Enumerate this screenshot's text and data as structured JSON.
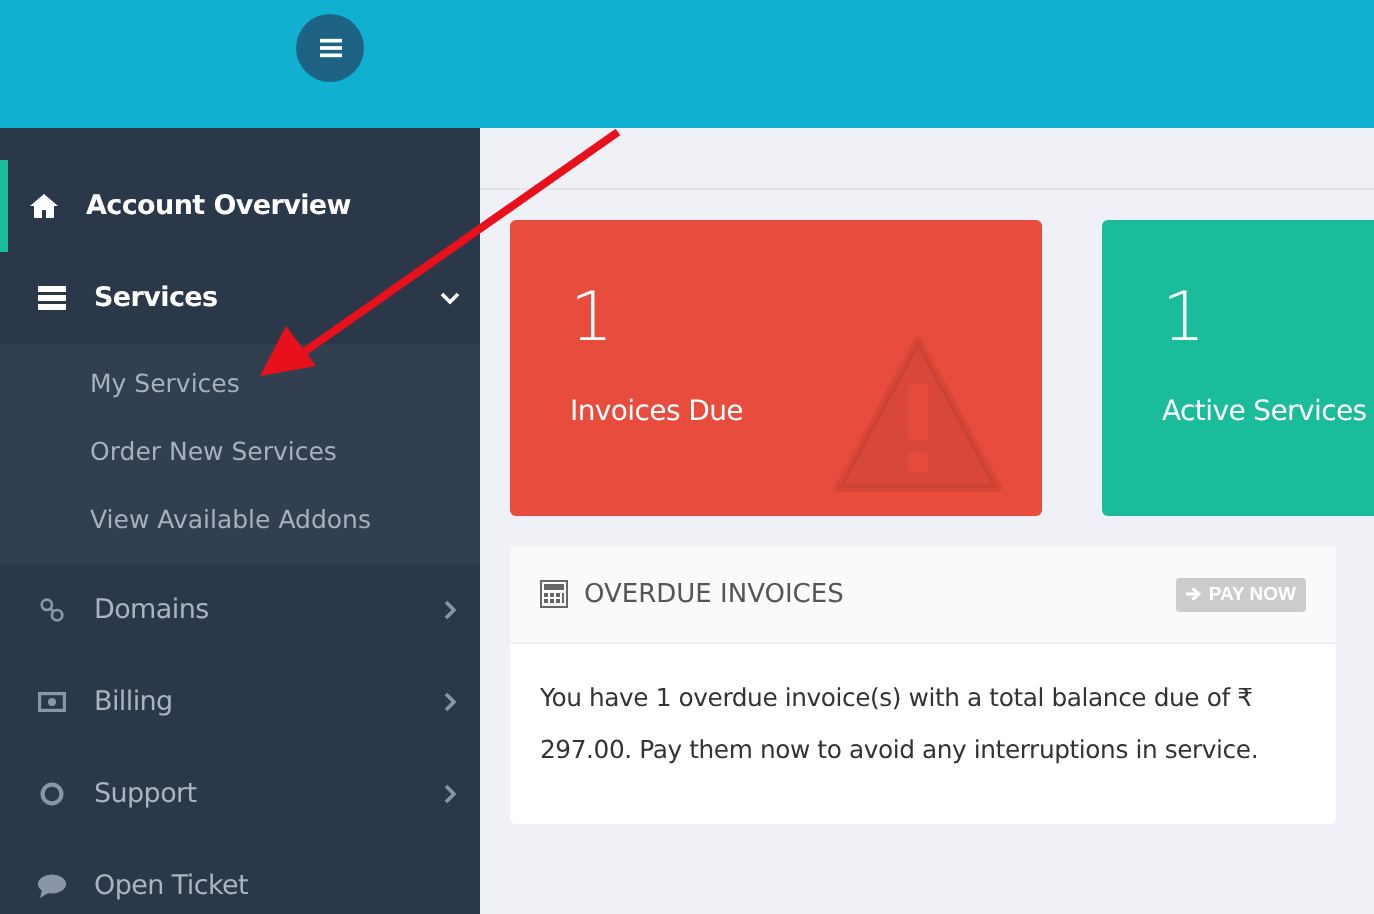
{
  "sidebar": {
    "items": [
      {
        "kind": "link",
        "label": "Account Overview",
        "selected": true
      },
      {
        "kind": "menu",
        "label": "Services",
        "selected": false,
        "expanded": true,
        "children": [
          {
            "label": "My Services"
          },
          {
            "label": "Order New Services"
          },
          {
            "label": "View Available Addons"
          }
        ]
      },
      {
        "kind": "menu",
        "label": "Domains",
        "selected": false,
        "expanded": false
      },
      {
        "kind": "menu",
        "label": "Billing",
        "selected": false,
        "expanded": false
      },
      {
        "kind": "menu",
        "label": "Support",
        "selected": false,
        "expanded": false
      },
      {
        "kind": "link",
        "label": "Open Ticket",
        "selected": false
      }
    ]
  },
  "tiles": [
    {
      "value": "1",
      "label": "Invoices Due",
      "color": "#e74c3c"
    },
    {
      "value": "1",
      "label": "Active Services",
      "color": "#1abc9c"
    }
  ],
  "panel": {
    "title": "OVERDUE INVOICES",
    "button": "PAY NOW",
    "text": "You have 1 overdue invoice(s) with a total balance due of ₹ 297.00. Pay them now to avoid any interruptions in service."
  }
}
